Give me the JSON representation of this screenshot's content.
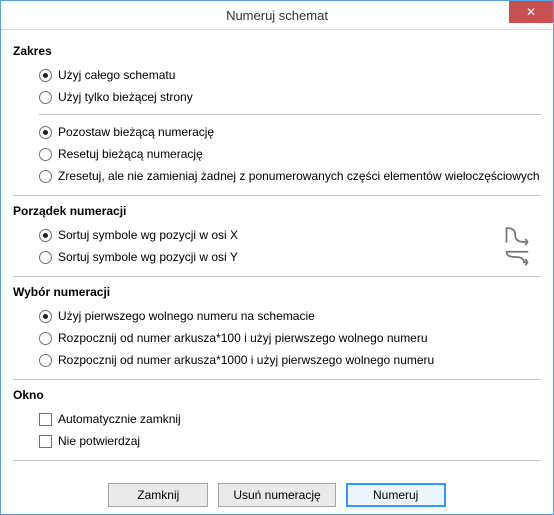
{
  "title": "Numeruj schemat",
  "sections": {
    "scope": {
      "title": "Zakres",
      "group1": [
        {
          "label": "Użyj całego schematu",
          "checked": true
        },
        {
          "label": "Użyj tylko bieżącej strony",
          "checked": false
        }
      ],
      "group2": [
        {
          "label": "Pozostaw bieżącą numerację",
          "checked": true
        },
        {
          "label": "Resetuj bieżącą numerację",
          "checked": false
        },
        {
          "label": "Zresetuj, ale nie zamieniaj żadnej z ponumerowanych części elementów wieloczęściowych",
          "checked": false
        }
      ]
    },
    "order": {
      "title": "Porządek numeracji",
      "options": [
        {
          "label": "Sortuj symbole wg pozycji w osi X",
          "checked": true
        },
        {
          "label": "Sortuj symbole wg pozycji w osi Y",
          "checked": false
        }
      ]
    },
    "choice": {
      "title": "Wybór numeracji",
      "options": [
        {
          "label": "Użyj pierwszego wolnego numeru na schemacie",
          "checked": true
        },
        {
          "label": "Rozpocznij od numer arkusza*100 i użyj pierwszego wolnego numeru",
          "checked": false
        },
        {
          "label": "Rozpocznij od numer arkusza*1000 i użyj pierwszego wolnego numeru",
          "checked": false
        }
      ]
    },
    "windowSec": {
      "title": "Okno",
      "options": [
        {
          "label": "Automatycznie zamknij",
          "checked": false
        },
        {
          "label": "Nie potwierdzaj",
          "checked": false
        }
      ]
    }
  },
  "buttons": {
    "close": "Zamknij",
    "remove": "Usuń numerację",
    "apply": "Numeruj"
  }
}
